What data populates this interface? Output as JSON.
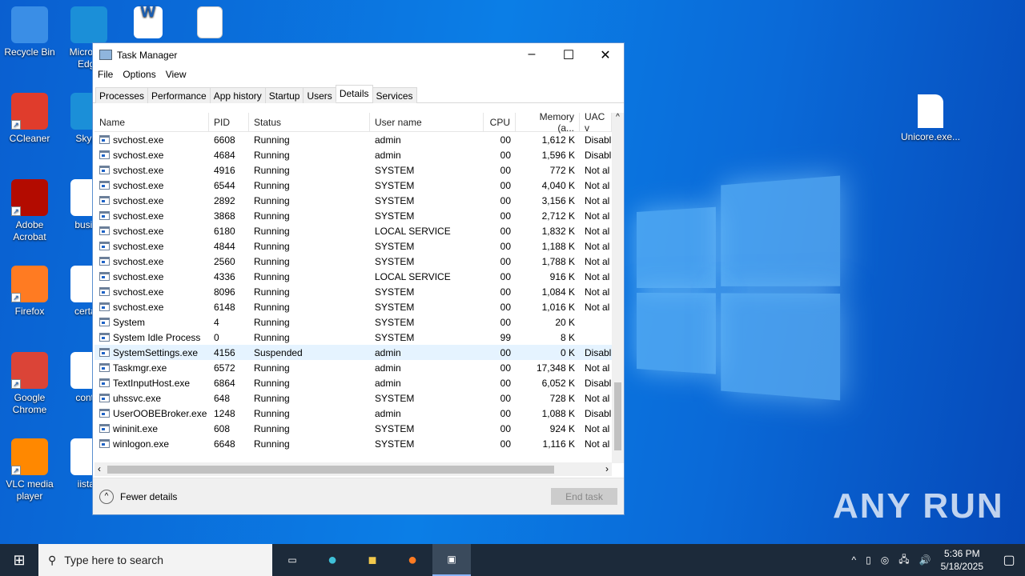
{
  "desktop": {
    "icons_left": [
      "Recycle Bin",
      "CCleaner",
      "Adobe Acrobat",
      "Firefox",
      "Google Chrome",
      "VLC media player"
    ],
    "icons_col2": [
      "Microsoft Edge",
      "Skype",
      "busine",
      "certain",
      "contro",
      "iistart"
    ],
    "icon_right": "Unicore.exe..."
  },
  "window": {
    "title": "Task Manager",
    "menu": [
      "File",
      "Options",
      "View"
    ],
    "tabs": [
      "Processes",
      "Performance",
      "App history",
      "Startup",
      "Users",
      "Details",
      "Services"
    ],
    "active_tab": "Details",
    "columns": [
      "Name",
      "PID",
      "Status",
      "User name",
      "CPU",
      "Memory (a...",
      "UAC v"
    ],
    "rows": [
      [
        "svchost.exe",
        "6608",
        "Running",
        "admin",
        "00",
        "1,612 K",
        "Disabl"
      ],
      [
        "svchost.exe",
        "4684",
        "Running",
        "admin",
        "00",
        "1,596 K",
        "Disabl"
      ],
      [
        "svchost.exe",
        "4916",
        "Running",
        "SYSTEM",
        "00",
        "772 K",
        "Not al"
      ],
      [
        "svchost.exe",
        "6544",
        "Running",
        "SYSTEM",
        "00",
        "4,040 K",
        "Not al"
      ],
      [
        "svchost.exe",
        "2892",
        "Running",
        "SYSTEM",
        "00",
        "3,156 K",
        "Not al"
      ],
      [
        "svchost.exe",
        "3868",
        "Running",
        "SYSTEM",
        "00",
        "2,712 K",
        "Not al"
      ],
      [
        "svchost.exe",
        "6180",
        "Running",
        "LOCAL SERVICE",
        "00",
        "1,832 K",
        "Not al"
      ],
      [
        "svchost.exe",
        "4844",
        "Running",
        "SYSTEM",
        "00",
        "1,188 K",
        "Not al"
      ],
      [
        "svchost.exe",
        "2560",
        "Running",
        "SYSTEM",
        "00",
        "1,788 K",
        "Not al"
      ],
      [
        "svchost.exe",
        "4336",
        "Running",
        "LOCAL SERVICE",
        "00",
        "916 K",
        "Not al"
      ],
      [
        "svchost.exe",
        "8096",
        "Running",
        "SYSTEM",
        "00",
        "1,084 K",
        "Not al"
      ],
      [
        "svchost.exe",
        "6148",
        "Running",
        "SYSTEM",
        "00",
        "1,016 K",
        "Not al"
      ],
      [
        "System",
        "4",
        "Running",
        "SYSTEM",
        "00",
        "20 K",
        ""
      ],
      [
        "System Idle Process",
        "0",
        "Running",
        "SYSTEM",
        "99",
        "8 K",
        ""
      ],
      [
        "SystemSettings.exe",
        "4156",
        "Suspended",
        "admin",
        "00",
        "0 K",
        "Disabl"
      ],
      [
        "Taskmgr.exe",
        "6572",
        "Running",
        "admin",
        "00",
        "17,348 K",
        "Not al"
      ],
      [
        "TextInputHost.exe",
        "6864",
        "Running",
        "admin",
        "00",
        "6,052 K",
        "Disabl"
      ],
      [
        "uhssvc.exe",
        "648",
        "Running",
        "SYSTEM",
        "00",
        "728 K",
        "Not al"
      ],
      [
        "UserOOBEBroker.exe",
        "1248",
        "Running",
        "admin",
        "00",
        "1,088 K",
        "Disabl"
      ],
      [
        "wininit.exe",
        "608",
        "Running",
        "SYSTEM",
        "00",
        "924 K",
        "Not al"
      ],
      [
        "winlogon.exe",
        "6648",
        "Running",
        "SYSTEM",
        "00",
        "1,116 K",
        "Not al"
      ]
    ],
    "selected_row": 14,
    "fewer_details": "Fewer details",
    "end_task": "End task"
  },
  "taskbar": {
    "search_placeholder": "Type here to search",
    "time": "5:36 PM",
    "date": "5/18/2025"
  },
  "watermark": "ANY RUN"
}
